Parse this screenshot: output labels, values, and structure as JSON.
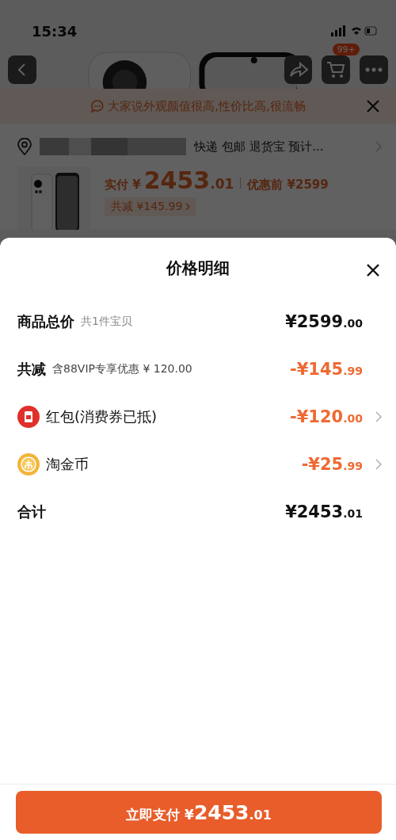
{
  "status_bar": {
    "time": "15:34"
  },
  "nav": {
    "cart_badge": "99+"
  },
  "banner": {
    "text": "大家说外观颜值很高,性价比高,很流畅"
  },
  "address": {
    "details": "快递 包邮 退货宝 预计..."
  },
  "product": {
    "paid_label": "实付 ¥",
    "paid_amount": "2453.01",
    "before_label": "优惠前 ¥2599",
    "saving_chip": "共减 ¥145.99"
  },
  "sheet": {
    "title": "价格明细",
    "rows": [
      {
        "kind": "subtotal",
        "label": "商品总价",
        "note": "共1件宝贝",
        "amount": "¥2599.00"
      },
      {
        "kind": "discount",
        "label": "共减",
        "note": "含88VIP专享优惠 ¥ 120.00",
        "amount": "-¥145.99"
      },
      {
        "kind": "coupon",
        "label": "红包(消费券已抵)",
        "amount": "-¥120.00"
      },
      {
        "kind": "coin",
        "label": "淘金币",
        "amount": "-¥25.99"
      },
      {
        "kind": "total",
        "label": "合计",
        "amount": "¥2453.01"
      }
    ]
  },
  "pay_button": {
    "label": "立即支付 ¥",
    "amount": "2453.01"
  }
}
